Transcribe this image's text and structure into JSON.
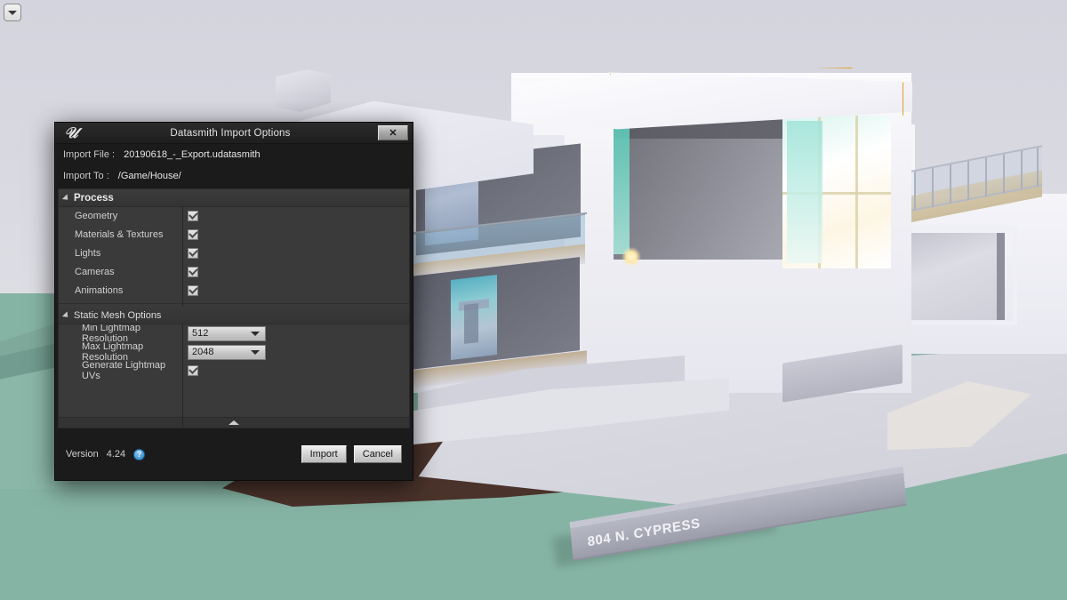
{
  "scene": {
    "sign_text": "804 N. CYPRESS",
    "colors": {
      "sky": "#d8d8e0",
      "ground": "#86b4a4",
      "soil": "#4a332b",
      "selection_outline": "#e0a11a",
      "concrete": "#d9d9e1"
    }
  },
  "corner_widget": {
    "icon": "chevron-down-icon"
  },
  "dialog": {
    "title": "Datasmith Import Options",
    "logo": "unreal-engine-logo",
    "close_label": "✕",
    "fields": [
      {
        "label": "Import File  :",
        "value": "20190618_-_Export.udatasmith"
      },
      {
        "label": "Import To   :",
        "value": "/Game/House/"
      }
    ],
    "sections": [
      {
        "title": "Process",
        "bold": true,
        "rows": [
          {
            "name": "Geometry",
            "type": "checkbox",
            "checked": true
          },
          {
            "name": "Materials & Textures",
            "type": "checkbox",
            "checked": true
          },
          {
            "name": "Lights",
            "type": "checkbox",
            "checked": true
          },
          {
            "name": "Cameras",
            "type": "checkbox",
            "checked": true
          },
          {
            "name": "Animations",
            "type": "checkbox",
            "checked": true
          }
        ]
      },
      {
        "title": "Static Mesh Options",
        "bold": false,
        "rows": [
          {
            "name": "Min Lightmap Resolution",
            "type": "combo",
            "value": "512"
          },
          {
            "name": "Max Lightmap Resolution",
            "type": "combo",
            "value": "2048"
          },
          {
            "name": "Generate Lightmap UVs",
            "type": "checkbox",
            "checked": true
          }
        ]
      }
    ],
    "footer": {
      "version_label": "Version",
      "version_number": "4.24",
      "help_icon": "help-icon",
      "help_glyph": "?",
      "import_label": "Import",
      "cancel_label": "Cancel"
    }
  }
}
